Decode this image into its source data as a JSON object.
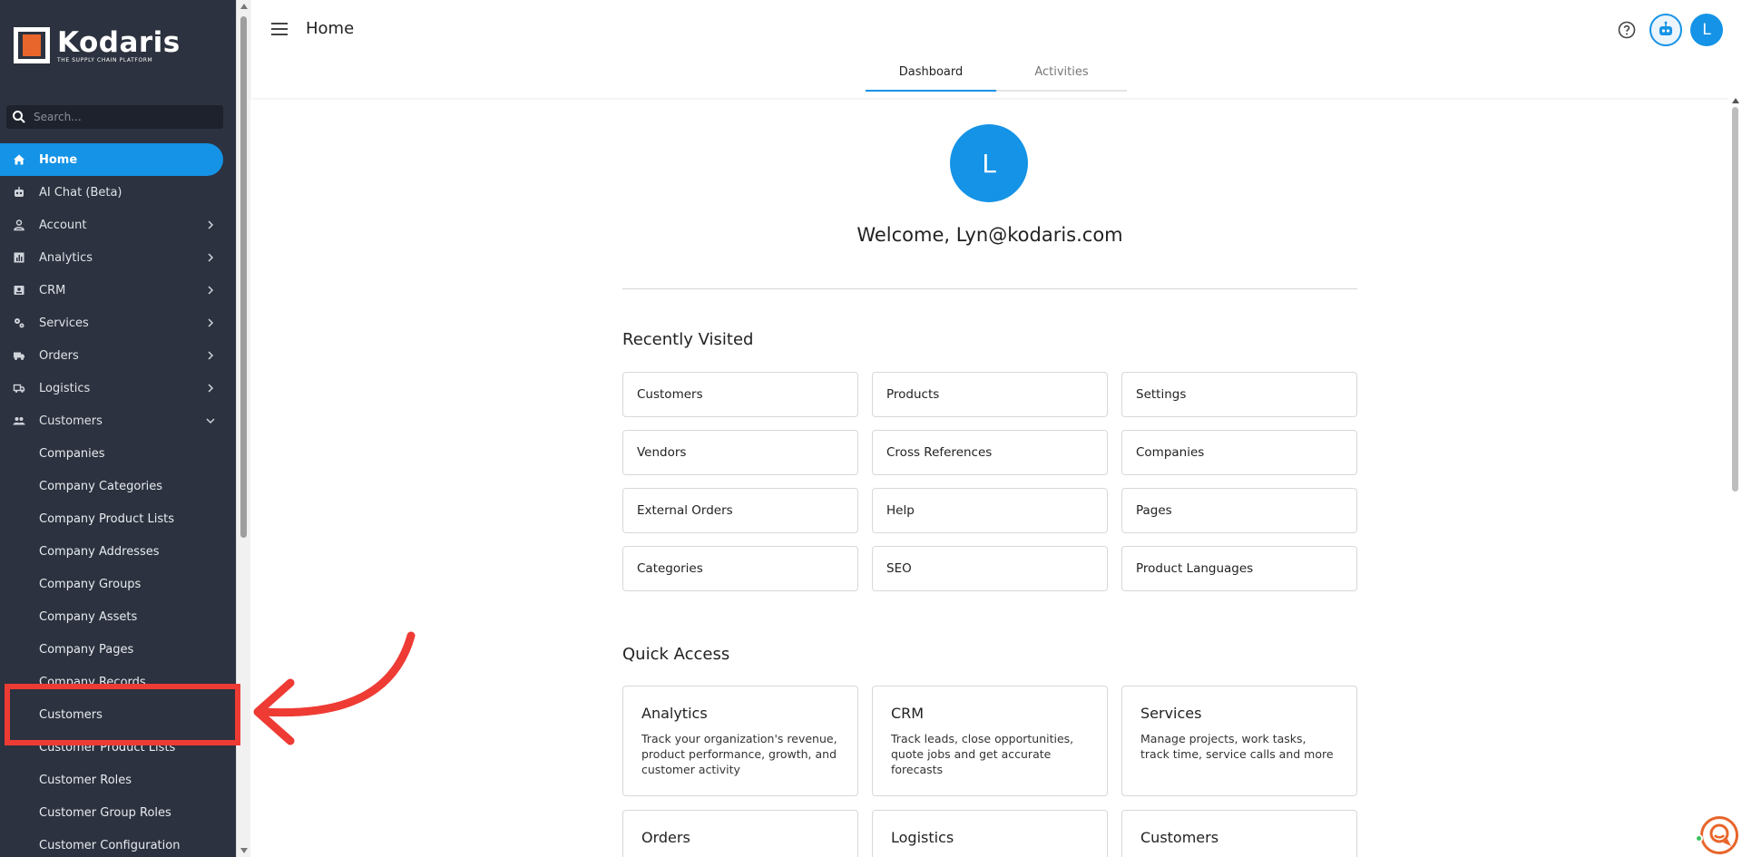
{
  "brand": {
    "name": "Kodaris",
    "tagline": "THE SUPPLY CHAIN PLATFORM"
  },
  "sidebar": {
    "search_placeholder": "Search...",
    "items": [
      {
        "label": "Home",
        "icon": "home-icon",
        "active": true
      },
      {
        "label": "AI Chat (Beta)",
        "icon": "robot-icon"
      },
      {
        "label": "Account",
        "icon": "person-icon",
        "chevron": "right"
      },
      {
        "label": "Analytics",
        "icon": "chart-icon",
        "chevron": "right"
      },
      {
        "label": "CRM",
        "icon": "contact-card-icon",
        "chevron": "right"
      },
      {
        "label": "Services",
        "icon": "gears-icon",
        "chevron": "right"
      },
      {
        "label": "Orders",
        "icon": "truck-icon",
        "chevron": "right"
      },
      {
        "label": "Logistics",
        "icon": "delivery-icon",
        "chevron": "right"
      },
      {
        "label": "Customers",
        "icon": "people-icon",
        "chevron": "down"
      }
    ],
    "sub_items": [
      "Companies",
      "Company Categories",
      "Company Product Lists",
      "Company Addresses",
      "Company Groups",
      "Company Assets",
      "Company Pages",
      "Company Records",
      "Customers",
      "Customer Product Lists",
      "Customer Roles",
      "Customer Group Roles",
      "Customer Configuration"
    ]
  },
  "header": {
    "title": "Home",
    "tabs": [
      "Dashboard",
      "Activities"
    ],
    "active_tab": "Dashboard",
    "avatar_initial": "L"
  },
  "main": {
    "avatar_initial": "L",
    "welcome": "Welcome, Lyn@kodaris.com",
    "recently_visited_title": "Recently Visited",
    "recently_visited": [
      "Customers",
      "Products",
      "Settings",
      "Vendors",
      "Cross References",
      "Companies",
      "External Orders",
      "Help",
      "Pages",
      "Categories",
      "SEO",
      "Product Languages"
    ],
    "quick_access_title": "Quick Access",
    "quick_access": [
      {
        "title": "Analytics",
        "desc": "Track your organization's revenue, product performance, growth, and customer activity"
      },
      {
        "title": "CRM",
        "desc": "Track leads, close opportunities, quote jobs and get accurate forecasts"
      },
      {
        "title": "Services",
        "desc": "Manage projects, work tasks, track time, service calls and more"
      },
      {
        "title": "Orders",
        "desc": ""
      },
      {
        "title": "Logistics",
        "desc": ""
      },
      {
        "title": "Customers",
        "desc": ""
      }
    ]
  },
  "colors": {
    "sidebar_bg": "#2c323f",
    "accent": "#1593e6",
    "brand_orange": "#e8652b",
    "annotation_red": "#ee3b34"
  }
}
